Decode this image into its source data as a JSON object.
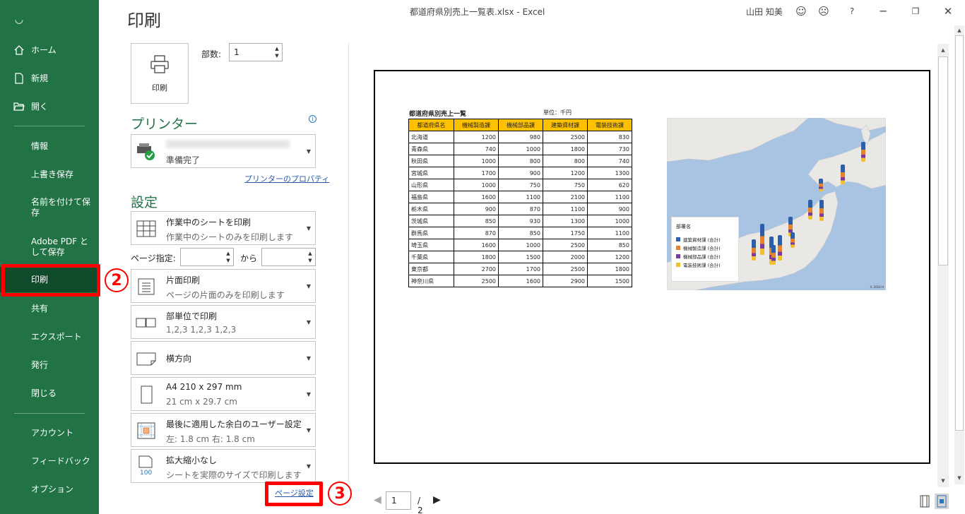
{
  "window": {
    "title": "都道府県別売上一覧表.xlsx  -  Excel",
    "user_name": "山田 知美",
    "help": "?"
  },
  "sidebar": {
    "items": [
      {
        "label": "ホーム",
        "icon": "home-icon"
      },
      {
        "label": "新規",
        "icon": "new-document-icon"
      },
      {
        "label": "開く",
        "icon": "open-folder-icon"
      },
      {
        "label": "情報"
      },
      {
        "label": "上書き保存"
      },
      {
        "label": "名前を付けて保存"
      },
      {
        "label": "Adobe PDF として保存"
      },
      {
        "label": "印刷"
      },
      {
        "label": "共有"
      },
      {
        "label": "エクスポート"
      },
      {
        "label": "発行"
      },
      {
        "label": "閉じる"
      },
      {
        "label": "アカウント"
      },
      {
        "label": "フィードバック"
      },
      {
        "label": "オプション"
      }
    ],
    "active": "印刷"
  },
  "annotations": {
    "badge2": "2",
    "badge3": "3",
    "color": "#ff0000"
  },
  "print": {
    "title": "印刷",
    "button_label": "印刷",
    "copies_label": "部数:",
    "copies_value": "1"
  },
  "printer": {
    "heading": "プリンター",
    "status": "準備完了",
    "properties_link": "プリンターのプロパティ"
  },
  "settings": {
    "heading": "設定",
    "pages_label": "ページ指定:",
    "pages_to": "から",
    "page_setup_link": "ページ設定",
    "dropdowns": [
      {
        "l1": "作業中のシートを印刷",
        "l2": "作業中のシートのみを印刷します",
        "icon": "sheet-icon"
      },
      {
        "l1": "片面印刷",
        "l2": "ページの片面のみを印刷します",
        "icon": "one-sided-icon"
      },
      {
        "l1": "部単位で印刷",
        "l2": "1,2,3    1,2,3    1,2,3",
        "icon": "collate-icon"
      },
      {
        "l1": "横方向",
        "l2": "",
        "icon": "landscape-icon"
      },
      {
        "l1": "A4 210 x 297 mm",
        "l2": "21 cm x 29.7 cm",
        "icon": "paper-size-icon"
      },
      {
        "l1": "最後に適用した余白のユーザー設定",
        "l2": "左:  1.8 cm    右:  1.8 cm",
        "icon": "margins-icon"
      },
      {
        "l1": "拡大縮小なし",
        "l2": "シートを実際のサイズで印刷します",
        "icon": "scaling-icon"
      }
    ]
  },
  "preview": {
    "sheet_title": "都道府県別売上一覧",
    "unit": "単位：千円",
    "table": {
      "headers": [
        "都道府県名",
        "機械製造課",
        "機械部品課",
        "建築資材課",
        "電装技術課"
      ],
      "rows": [
        [
          "北海道",
          "1200",
          "980",
          "2500",
          "830"
        ],
        [
          "青森県",
          "740",
          "1000",
          "1800",
          "730"
        ],
        [
          "秋田県",
          "1000",
          "800",
          "800",
          "740"
        ],
        [
          "宮城県",
          "1700",
          "900",
          "1200",
          "1300"
        ],
        [
          "山形県",
          "1000",
          "750",
          "750",
          "620"
        ],
        [
          "福島県",
          "1600",
          "1100",
          "2100",
          "1100"
        ],
        [
          "栃木県",
          "900",
          "870",
          "1100",
          "900"
        ],
        [
          "茨城県",
          "850",
          "930",
          "1300",
          "1000"
        ],
        [
          "群馬県",
          "870",
          "850",
          "1750",
          "1100"
        ],
        [
          "埼玉県",
          "1600",
          "1000",
          "2500",
          "850"
        ],
        [
          "千葉県",
          "1800",
          "1500",
          "2000",
          "1200"
        ],
        [
          "東京都",
          "2700",
          "1700",
          "2500",
          "1800"
        ],
        [
          "神奈川県",
          "2500",
          "1600",
          "2900",
          "1500"
        ]
      ]
    },
    "map_legend": {
      "title": "部署名",
      "entries": [
        {
          "label": "建築資材課 (合計)",
          "color": "#2b5faa"
        },
        {
          "label": "機械製造課 (合計)",
          "color": "#e8822a"
        },
        {
          "label": "機械部品課 (合計)",
          "color": "#7a3aa0"
        },
        {
          "label": "電装技術課 (合計)",
          "color": "#f2c02a"
        }
      ],
      "copyright": "© 2016 H"
    },
    "pager": {
      "current": "1",
      "total": "/ 2"
    }
  }
}
